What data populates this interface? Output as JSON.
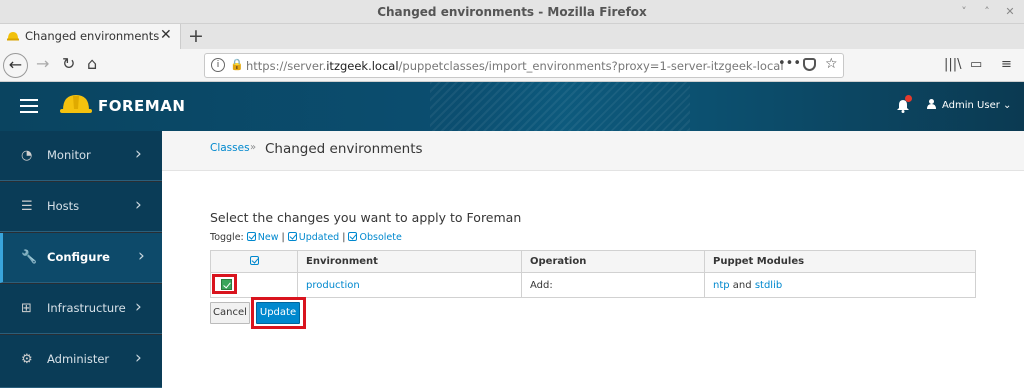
{
  "window": {
    "title": "Changed environments - Mozilla Firefox",
    "controls": [
      "minimize",
      "maximize",
      "close"
    ]
  },
  "browser": {
    "tab_label": "Changed environments",
    "url_host": "https://server.",
    "url_domain": "itzgeek.local",
    "url_path": "/puppetclasses/import_environments?proxy=1-server-itzgeek-local"
  },
  "header": {
    "brand": "FOREMAN",
    "user": "Admin User"
  },
  "sidebar": {
    "items": [
      {
        "label": "Monitor",
        "icon": "dashboard-icon"
      },
      {
        "label": "Hosts",
        "icon": "server-icon"
      },
      {
        "label": "Configure",
        "icon": "wrench-icon",
        "active": true
      },
      {
        "label": "Infrastructure",
        "icon": "sitemap-icon"
      },
      {
        "label": "Administer",
        "icon": "gear-icon"
      }
    ]
  },
  "breadcrumb": {
    "parent": "Classes",
    "separator": "»",
    "current": "Changed environments"
  },
  "main": {
    "prompt": "Select the changes you want to apply to Foreman",
    "toggle_label": "Toggle:",
    "toggle_new": "New",
    "toggle_updated": "Updated",
    "toggle_obsolete": "Obsolete",
    "toggle_sep": "|"
  },
  "table": {
    "headers": [
      "Environment",
      "Operation",
      "Puppet Modules"
    ],
    "row": {
      "environment": "production",
      "operation": "Add:",
      "module1": "ntp",
      "and": "and",
      "module2": "stdlib",
      "checked": true
    }
  },
  "buttons": {
    "cancel": "Cancel",
    "update": "Update"
  },
  "colors": {
    "accent": "#0088ce",
    "highlight": "#d9141e",
    "header": "#0b4e70",
    "sidebar": "#0a3c57"
  }
}
